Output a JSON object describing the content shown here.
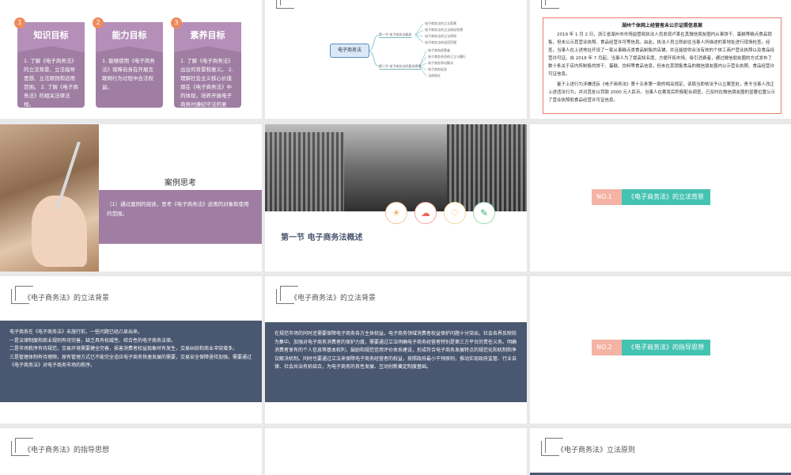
{
  "s1": {
    "cards": [
      {
        "num": "1",
        "title": "知识目标",
        "body": "1. 了解《电子商务法》的立法背景、立法指导思想、立法原则和适用范围。 2. 了解《电子商务法》的相关法律法规。"
      },
      {
        "num": "2",
        "title": "能力目标",
        "body": "1. 能够使用《电子商务法》保障自身在开展互联网行为过程中合法权益。"
      },
      {
        "num": "3",
        "title": "素养目标",
        "body": "1. 了解《电子商务法》出台的背景和意义。 2. 理解社会主义核心价值观在《电子商务法》中的体现，培养开展电子商务时遵纪守法的意识。"
      }
    ]
  },
  "s2": {
    "root": "电子商务法",
    "branch1": "第一节 电子商务法概述",
    "branch2": "第二节 电子商务法的基本原则",
    "leaves1": [
      "电子商务法的立法背景",
      "电子商务法的立法指导思想",
      "电子商务法的立法原则",
      "电子商务法的适用范围"
    ],
    "leaves2": [
      "电子商务经营者",
      "电子商务合同的订立与履行",
      "电子商务争议解决",
      "电子商务促进",
      "法律责任"
    ]
  },
  "s3": {
    "title": "湖州个体网上经营者未公示证照信息案",
    "p1": "2019 年 1 月 2 日，浙江省湖州市市场监管局执法人员发现卢某在其微信朋友圈内从事饼干、蛋糕等糕点食品销售，但未公示其营业执照、食品经营许可等信息。由此，执法人员立即前往当事人所描述的某地址进行现场检查。经查，当事人在上述地址开设了一家从事糕点类食品制售的店铺，并且能提供合法有效的个体工商户营业执照以及食品经营许可证。自 2018 年 7 月起，当事人为了提高知名度，方便开拓市场、吸引消费者，通过微信朋友圈的方式发布了数十条关于店内所制售的饼干、蛋糕、饮料等食品信息，但未在其销售食品的微信朋友圈内公示营业执照、食品经营许可证信息。",
    "p2": "鉴于上述行为涉嫌违反《电子商务法》第十五条第一款的相关规定，该局当即依法予以立案查处，责令当事人改正上述违法行为，并对其处以罚款 2000 元人民币。当事人在案发后积极配合调查，已及时在微信朋友圈的显著位置公示了营业执照和食品经营许可证信息。"
  },
  "s4": {
    "heading": "案例思考",
    "question": "（1）通过案例的阅读，思考《电子商务法》适用的对象和使用的范围。"
  },
  "s5": {
    "section_title": "第一节 电子商务法概述",
    "icons": [
      "lightbulb-icon",
      "cloud-icon",
      "heart-icon",
      "pen-icon"
    ]
  },
  "s6": {
    "no": "NO.1",
    "label": "《电子商务法》的立法背景"
  },
  "s7": {
    "title": "《电子商务法》的立法背景",
    "lines": [
      "电子商务在《电子商务法》未施行前，一些问题已经凸显出来。",
      "一是法律制度和商业规则有待完善，缺乏具有权威性、综合性的电子商务法律。",
      "二是市场秩序有待规范，交易环境需要健全完善，损害消费者权益现象时有发生，交易纠纷和商业冲突增多。",
      "三是管理体制有待理顺，原有管理方式已不能完全适应电子商务快速发展的需要，交易安全保障亟待加强，需要通过《电子商务法》对电子商务市场的秩序。"
    ]
  },
  "s8": {
    "title": "《电子商务法》的立法背景",
    "body": "在规范市场的同时还需要保障电子商务各方主体权益。电子商务领域消费者权益保护问题十分突出，社会各界反映较为集中。加强对电子商务消费者的保护力度，需要通过立法明确电子商务经营者特别是第三方平台的责任义务。明确消费者享有的个人信息等基本权利，鼓励和规范信用评价体系建设，形成符合电子商务发展特点的规范化和机制和争议解决机制。同时也要通过立法来保障电子商务经营者的权益，按照政府最小干预原则，推动实现政府监管、行业自律、社会共治有机结合，为电子商务的良性发展、互动创新奠定制度基础。"
  },
  "s9": {
    "no": "NO.2",
    "label": "《电子商务法》的指导思想"
  },
  "s10": {
    "title": "《电子商务法》的指导思想"
  },
  "s12": {
    "title": "《电子商务法》立法原则"
  }
}
